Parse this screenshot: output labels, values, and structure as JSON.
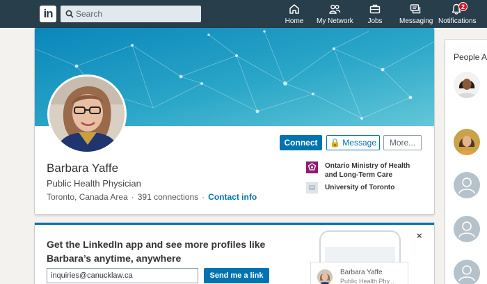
{
  "nav": {
    "logo_text": "in",
    "search_placeholder": "Search",
    "items": [
      {
        "label": "Home",
        "icon": "home-icon"
      },
      {
        "label": "My Network",
        "icon": "network-icon"
      },
      {
        "label": "Jobs",
        "icon": "briefcase-icon"
      },
      {
        "label": "Messaging",
        "icon": "messaging-icon"
      },
      {
        "label": "Notifications",
        "icon": "bell-icon",
        "badge": "2"
      }
    ]
  },
  "profile": {
    "name": "Barbara Yaffe",
    "headline": "Public Health Physician",
    "location": "Toronto, Canada Area",
    "connections": "391 connections",
    "contact_info": "Contact info",
    "buttons": {
      "connect": "Connect",
      "message": "Message",
      "more": "More..."
    },
    "experience": [
      {
        "org": "Ontario Ministry of Health and Long-Term Care",
        "icon": "ontario-trillium-logo"
      },
      {
        "org": "University of Toronto",
        "icon": "school-placeholder-icon"
      }
    ]
  },
  "promo": {
    "heading": "Get the LinkedIn app and see more profiles like Barbara’s anytime, anywhere",
    "email_value": "inquiries@canucklaw.ca",
    "send_button": "Send me a link",
    "close": "×",
    "mini_card": {
      "name": "Barbara Yaffe",
      "headline": "Public Health Phy..."
    }
  },
  "rail": {
    "title": "People Al"
  },
  "colors": {
    "nav_bg": "#283e4a",
    "accent": "#0073b1",
    "banner_start": "#0077b5",
    "banner_end": "#5bc0d6",
    "badge": "#d11124"
  }
}
